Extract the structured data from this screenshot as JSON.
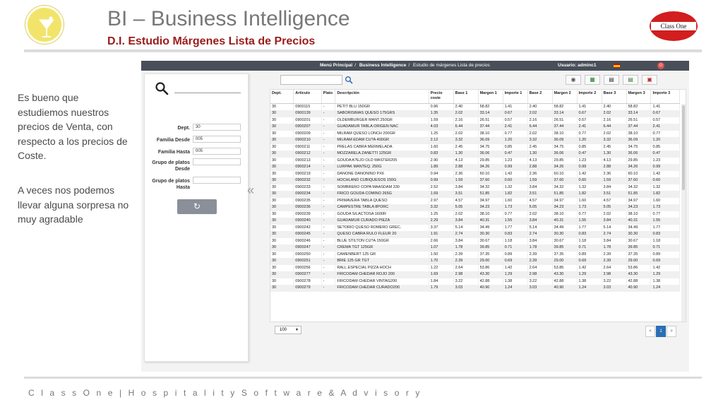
{
  "slide": {
    "title": "BI – Business Intelligence",
    "subtitle": "D.I. Estudio Márgenes Lista de Precios",
    "logo_right_text": "Class One",
    "paragraph1": "Es bueno que estudiemos nuestros precios de Venta, con respecto a los precios de Coste.",
    "paragraph2": "A veces nos podemos llevar alguna sorpresa no muy agradable",
    "footer": "C l a s s O n e | H o s p i t a l i t y S o f t w a r e & A d v i s o r y"
  },
  "app": {
    "breadcrumb": {
      "home": "Menú Principal",
      "section": "Business Intelligence",
      "page": "Estudio de márgenes Lista de precios"
    },
    "user_label": "Usuario: adminc1",
    "filters": {
      "dept_label": "Dept.",
      "dept_value": "30",
      "familia_desde_label": "Familia Desde",
      "familia_desde_value": "005",
      "familia_hasta_label": "Familia Hasta",
      "familia_hasta_value": "005",
      "grupo_desde_label_1": "Grupo de platos",
      "grupo_desde_label_2": "Desde",
      "grupo_desde_value": "",
      "grupo_hasta_label_1": "Grupo de platos",
      "grupo_hasta_label_2": "Hasta",
      "grupo_hasta_value": ""
    },
    "refresh_icon": "refresh-icon",
    "collapse_glyph": "«",
    "toolbar_icons": [
      "eye-icon",
      "excel-icon",
      "print-icon",
      "print-alt-icon",
      "pdf-icon"
    ],
    "table": {
      "columns": [
        "Dept.",
        "Artículo",
        "Plato",
        "Descripción",
        "Precio coste",
        "Base 1",
        "Margen 1",
        "Importe 1",
        "Base 2",
        "Margen 2",
        "Importe 2",
        "Base 3",
        "Margen 3",
        "Importe 3"
      ],
      "rows": [
        [
          "30",
          "0900115",
          "-",
          "PETIT BLU 150GR",
          "0.96",
          "2.40",
          "58.82",
          "1.41",
          "2.40",
          "58.82",
          "1.41",
          "2.40",
          "58.82",
          "1.41"
        ],
        [
          "30",
          "0900139",
          "-",
          "SABORISIMAS QUESO 175GRS",
          "1.35",
          "2.02",
          "33.14",
          "0.67",
          "2.02",
          "33.14",
          "0.67",
          "2.02",
          "33.14",
          "0.67"
        ],
        [
          "30",
          "0900201",
          "-",
          "OLDEMBURGER MANT.250GR",
          "1.59",
          "2.16",
          "26.51",
          "0.57",
          "2.16",
          "26.51",
          "0.57",
          "2.16",
          "26.51",
          "0.57"
        ],
        [
          "30",
          "0900207",
          "-",
          "GUADAMUR TABLA ORIGEN NAC",
          "4.03",
          "6.44",
          "37.44",
          "2.41",
          "6.44",
          "37.44",
          "2.41",
          "6.44",
          "37.44",
          "2.41"
        ],
        [
          "30",
          "0900209",
          "-",
          "MILRAM QUESO LONCH 200GR",
          "1.25",
          "2.02",
          "38.10",
          "0.77",
          "2.02",
          "38.10",
          "0.77",
          "2.02",
          "38.10",
          "0.77"
        ],
        [
          "30",
          "0900210",
          "-",
          "MILRAM EDAM CU?A 400GR",
          "2.12",
          "3.32",
          "36.09",
          "1.20",
          "3.32",
          "36.09",
          "1.20",
          "3.32",
          "36.09",
          "1.20"
        ],
        [
          "30",
          "0900211",
          "-",
          "PRELAS CABRA MERMELADA",
          "1.60",
          "2.45",
          "34.75",
          "0.85",
          "2.45",
          "34.75",
          "0.85",
          "2.45",
          "34.75",
          "0.85"
        ],
        [
          "30",
          "0900212",
          "-",
          "MOZZARELA ZANETTI 125GR",
          "0.83",
          "1.30",
          "36.06",
          "0.47",
          "1.30",
          "36.06",
          "0.47",
          "1.30",
          "36.06",
          "0.47"
        ],
        [
          "30",
          "0900213",
          "-",
          "GOUDA A?EJO OLD MASTER205",
          "2.90",
          "4.13",
          "29.85",
          "1.23",
          "4.13",
          "29.85",
          "1.23",
          "4.13",
          "29.85",
          "1.23"
        ],
        [
          "30",
          "0900214",
          "-",
          "LURPAK MANTEQ. 250G",
          "1.89",
          "2.88",
          "34.26",
          "0.99",
          "2.88",
          "34.26",
          "0.99",
          "2.88",
          "34.26",
          "0.99"
        ],
        [
          "30",
          "0900219",
          "-",
          "DANONE DANONINO PX6",
          "0.94",
          "2.36",
          "60.10",
          "1.42",
          "2.36",
          "60.10",
          "1.42",
          "2.36",
          "60.10",
          "1.42"
        ],
        [
          "30",
          "0900232",
          "-",
          "HOCHLAND CUBIQUESOS 150G",
          "0.99",
          "1.59",
          "37.60",
          "0.60",
          "1.59",
          "37.60",
          "0.60",
          "1.59",
          "37.60",
          "0.60"
        ],
        [
          "30",
          "0900233",
          "-",
          "SOMBRERO COPA MAASDAM 330",
          "2.52",
          "3.84",
          "34.32",
          "1.32",
          "3.84",
          "34.32",
          "1.32",
          "3.84",
          "34.32",
          "1.32"
        ],
        [
          "30",
          "0900234",
          "-",
          "FRICO GOUDA COMINO 265G",
          "1.69",
          "3.51",
          "51.85",
          "1.82",
          "3.51",
          "51.85",
          "1.82",
          "3.51",
          "51.85",
          "1.82"
        ],
        [
          "30",
          "0900235",
          "-",
          "PRIMAVERA TABLA QUESO",
          "2.97",
          "4.57",
          "34.97",
          "1.60",
          "4.57",
          "34.97",
          "1.60",
          "4.57",
          "34.97",
          "1.60"
        ],
        [
          "30",
          "0900236",
          "-",
          "CAMPESTRE TABLA 8PORC",
          "3.32",
          "5.05",
          "34.23",
          "1.73",
          "5.05",
          "34.23",
          "1.73",
          "5.05",
          "34.23",
          "1.73"
        ],
        [
          "30",
          "0900239",
          "-",
          "GOUDA S/LACTOSA 1600R",
          "1.25",
          "2.02",
          "38.10",
          "0.77",
          "2.02",
          "38.10",
          "0.77",
          "2.02",
          "38.10",
          "0.77"
        ],
        [
          "30",
          "0900240",
          "-",
          "GUADAMUR CURADO PIEZA",
          "2.29",
          "3.84",
          "40.31",
          "1.55",
          "3.84",
          "40.31",
          "1.55",
          "3.84",
          "40.31",
          "1.55"
        ],
        [
          "30",
          "0900242",
          "-",
          "SE?ORIO QUESO ROMERO GREC.",
          "3.37",
          "5.14",
          "34.49",
          "1.77",
          "5.14",
          "34.49",
          "1.77",
          "5.14",
          "34.49",
          "1.77"
        ],
        [
          "30",
          "0900245",
          "-",
          "QUESO CABRA RULO FLEUR 20",
          "1.91",
          "2.74",
          "30.30",
          "0.83",
          "2.74",
          "30.30",
          "0.83",
          "2.74",
          "30.30",
          "0.83"
        ],
        [
          "30",
          "0900246",
          "-",
          "BLUE STILTON CU?A 150GR",
          "2.66",
          "3.84",
          "30.67",
          "1.18",
          "3.84",
          "30.67",
          "1.18",
          "3.84",
          "30.67",
          "1.18"
        ],
        [
          "30",
          "0900247",
          "-",
          "CREMA TGT 125GR",
          "1.07",
          "1.78",
          "39.85",
          "0.71",
          "1.78",
          "39.85",
          "0.71",
          "1.78",
          "39.85",
          "0.71"
        ],
        [
          "30",
          "0900250",
          "-",
          "CAMENBERT 125 GR",
          "1.50",
          "2.39",
          "37.35",
          "0.89",
          "2.39",
          "37.35",
          "0.89",
          "2.39",
          "37.35",
          "0.89"
        ],
        [
          "30",
          "0900251",
          "-",
          "BRIE 125 GR TGT",
          "1.70",
          "2.39",
          "29.00",
          "0.69",
          "2.39",
          "29.00",
          "0.69",
          "2.39",
          "29.00",
          "0.69"
        ],
        [
          "30",
          "0900256",
          "-",
          "RALL.ESPECIAL PIZZA HOCH",
          "1.22",
          "2.64",
          "53.86",
          "1.42",
          "2.64",
          "53.86",
          "1.42",
          "2.64",
          "53.86",
          "1.42"
        ],
        [
          "30",
          "0900277",
          "-",
          "FRICODAM CHEDAR ROJO 200",
          "1.69",
          "2.98",
          "43.30",
          "1.29",
          "2.98",
          "43.30",
          "1.29",
          "2.98",
          "43.30",
          "1.29"
        ],
        [
          "30",
          "0900278",
          "-",
          "FRICODAM CHEDAR VINTAG200",
          "1.84",
          "3.22",
          "42.88",
          "1.38",
          "3.22",
          "42.88",
          "1.38",
          "3.22",
          "42.88",
          "1.38"
        ],
        [
          "30",
          "0900279",
          "-",
          "FRICODAM CHEDAR CURADO200",
          "1.79",
          "3.03",
          "40.90",
          "1.24",
          "3.03",
          "40.90",
          "1.24",
          "3.03",
          "40.90",
          "1.24"
        ]
      ]
    },
    "page_size": "100",
    "pager": {
      "prev": "<",
      "current": "1",
      "next": ">"
    }
  },
  "colors": {
    "title_grey": "#777777",
    "subtitle_red": "#9b1c1c",
    "navbar": "#484f59",
    "brand_red": "#d21e1e",
    "logo_yellow": "#f2e46a"
  }
}
